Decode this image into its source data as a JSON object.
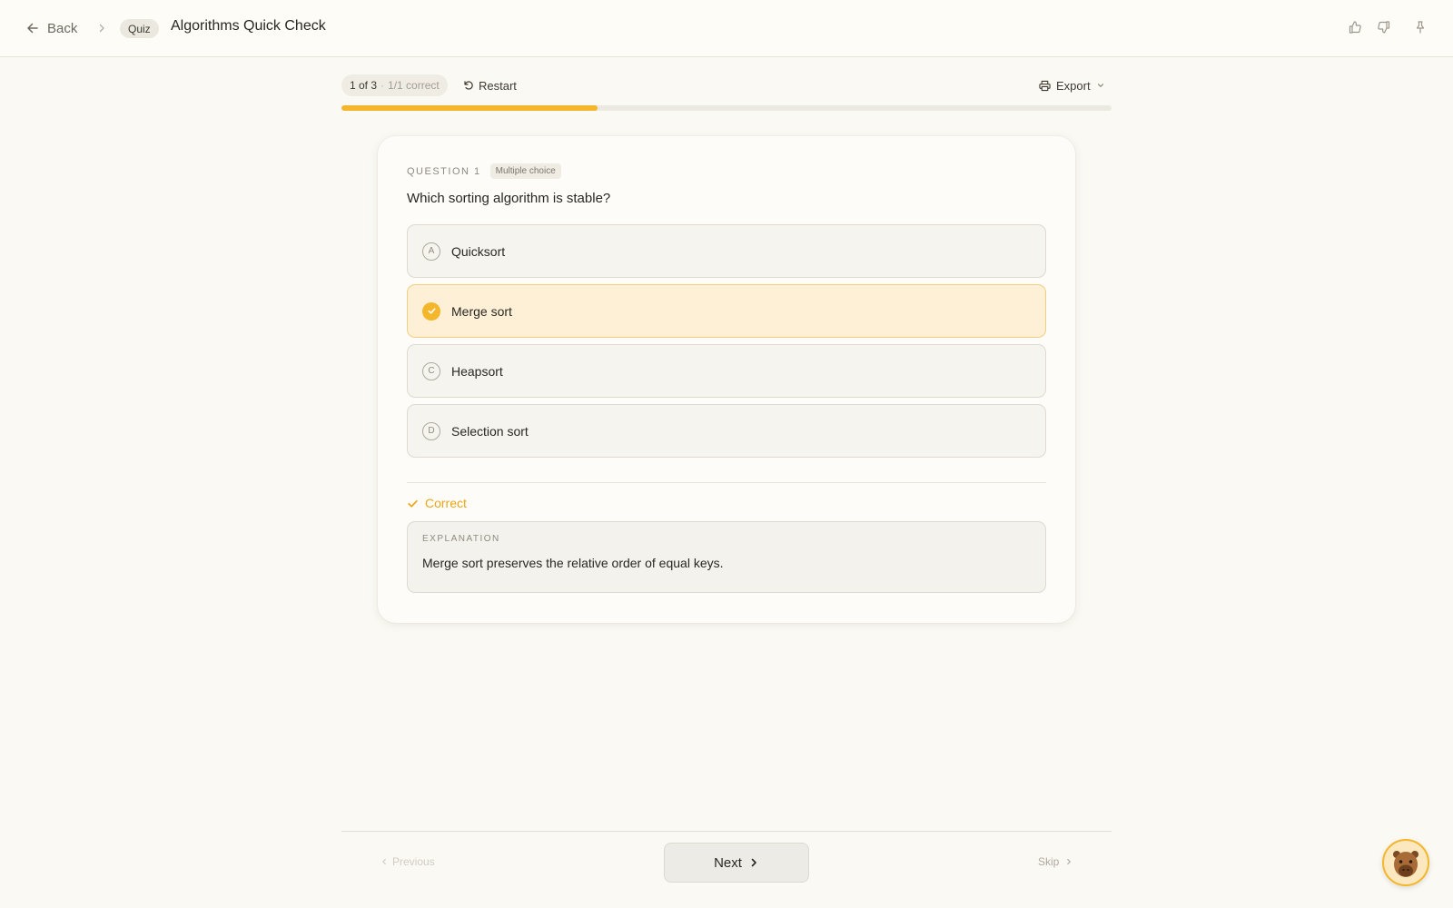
{
  "header": {
    "back_label": "Back",
    "chip_label": "Quiz",
    "title": "Algorithms Quick Check"
  },
  "toolbar": {
    "position": "1 of 3",
    "separator": "·",
    "score": "1/1 correct",
    "restart_label": "Restart",
    "export_label": "Export",
    "progress_fraction": 0.333
  },
  "question": {
    "label": "QUESTION 1",
    "type": "Multiple choice",
    "text": "Which sorting algorithm is stable?",
    "options": [
      {
        "letter": "A",
        "text": "Quicksort",
        "selected": false
      },
      {
        "letter": "B",
        "text": "Merge sort",
        "selected": true
      },
      {
        "letter": "C",
        "text": "Heapsort",
        "selected": false
      },
      {
        "letter": "D",
        "text": "Selection sort",
        "selected": false
      }
    ]
  },
  "result": {
    "status": "Correct",
    "explanation_label": "EXPLANATION",
    "explanation": "Merge sort preserves the relative order of equal keys."
  },
  "footer": {
    "previous_label": "Previous",
    "next_label": "Next",
    "skip_label": "Skip"
  },
  "colors": {
    "accent": "#f4b62a",
    "selected_bg": "#fdf0d6",
    "background": "#fbf9f3"
  },
  "icons": {
    "back": "arrow-left-icon",
    "thumbs_up": "thumbs-up-icon",
    "thumbs_down": "thumbs-down-icon",
    "pin": "pin-icon",
    "restart": "rotate-ccw-icon",
    "export": "printer-icon",
    "mascot": "capybara-avatar-icon"
  }
}
